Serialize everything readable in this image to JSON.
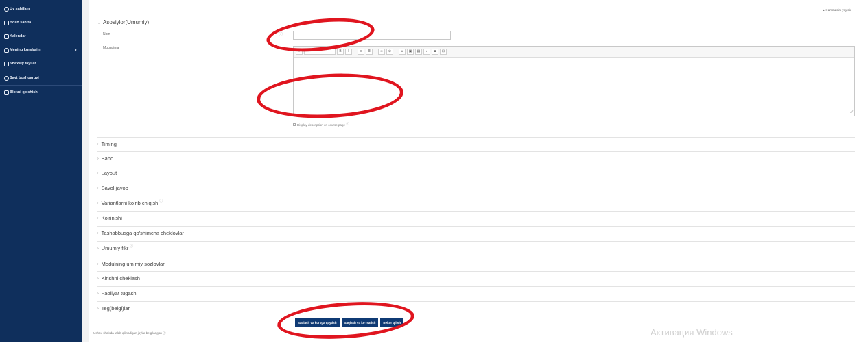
{
  "sidebar": {
    "items": [
      {
        "label": "Uy sahifam",
        "icon": "home-icon"
      },
      {
        "label": "Bosh sahifa",
        "icon": "house-icon"
      },
      {
        "label": "Kalendar",
        "icon": "calendar-icon"
      },
      {
        "label": "Mening kurslarim",
        "icon": "graduation-icon"
      },
      {
        "label": "Shaxsiy fayllar",
        "icon": "file-icon"
      },
      {
        "label": "Sayt boshqaruvi",
        "icon": "gear-icon"
      },
      {
        "label": "Blokni qo'shish",
        "icon": "plus-box-icon"
      }
    ]
  },
  "main": {
    "expand_all": "▸ Hammasini yoyish",
    "general_section": "Asosiylor(Umumiy)",
    "name_label": "Nom",
    "description_label": "Muqadima",
    "display_description": "Display description on course page",
    "sections": [
      "Timing",
      "Baho",
      "Layout",
      "Savol-javob",
      "Variantlarni ko'rib chiqish",
      "Ko'rinishi",
      "Tashabbusga qo'shimcha cheklovlar",
      "Umumiy fikr",
      "Modulning umimiy sozlovlari",
      "Kirishni cheklash",
      "Faoliyat tugashi",
      "Teg(belgi)lar"
    ],
    "buttons": {
      "save_return": "Saqlash va kursga qaytish",
      "save_display": "Saqlash va ko'rsatish",
      "cancel": "Bekor qilish"
    },
    "required_note": "Ushbu shaklda talab qilinadigan joylar belgilangan ⓘ .",
    "watermark": "Активация Windows"
  },
  "colors": {
    "sidebar_bg": "#0f2f5c",
    "button_bg": "#0f3a74",
    "annotation_red": "#e0151f"
  }
}
